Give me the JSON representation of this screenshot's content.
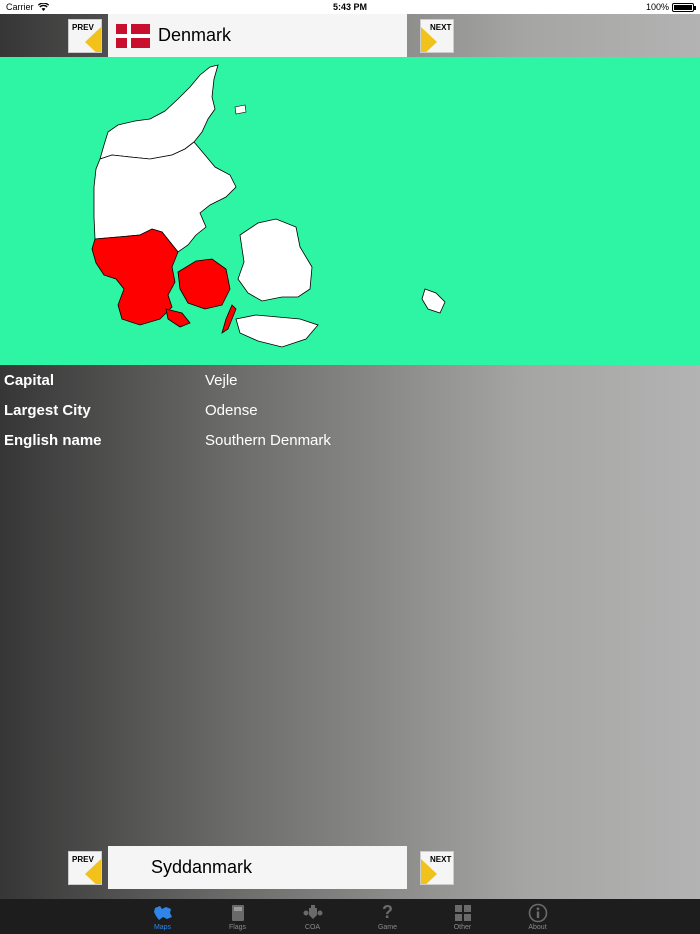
{
  "status_bar": {
    "carrier": "Carrier",
    "time": "5:43 PM",
    "battery": "100%"
  },
  "top_nav": {
    "prev_label": "PREV",
    "next_label": "NEXT",
    "country": "Denmark"
  },
  "info": [
    {
      "key": "Capital",
      "value": "Vejle"
    },
    {
      "key": "Largest City",
      "value": "Odense"
    },
    {
      "key": "English name",
      "value": "Southern Denmark"
    }
  ],
  "bottom_nav": {
    "prev_label": "PREV",
    "next_label": "NEXT",
    "region": "Syddanmark"
  },
  "tabs": [
    {
      "label": "Maps",
      "icon": "europe-map-icon",
      "active": true
    },
    {
      "label": "Flags",
      "icon": "flag-book-icon",
      "active": false
    },
    {
      "label": "COA",
      "icon": "coat-of-arms-icon",
      "active": false
    },
    {
      "label": "Game",
      "icon": "question-mark-icon",
      "active": false
    },
    {
      "label": "Other",
      "icon": "grid-icon",
      "active": false
    },
    {
      "label": "About",
      "icon": "info-icon",
      "active": false
    }
  ],
  "colors": {
    "sea": "#2ef5a3",
    "highlight_region": "#ff0000",
    "land": "#ffffff",
    "accent": "#2f86e8",
    "arrow": "#f2c21c"
  }
}
